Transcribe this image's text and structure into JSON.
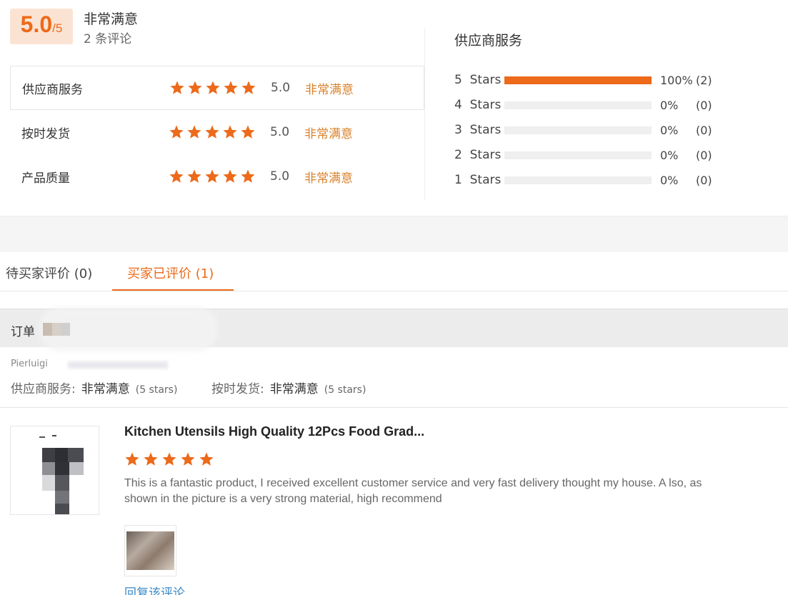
{
  "colors": {
    "accent": "#ec6a1a",
    "link": "#3a88c7"
  },
  "summary": {
    "score": "5.0",
    "score_max": "/5",
    "desc": "非常满意",
    "count": "2 条评论",
    "rows": [
      {
        "label": "供应商服务",
        "stars": 5,
        "value": "5.0",
        "word": "非常满意"
      },
      {
        "label": "按时发货",
        "stars": 5,
        "value": "5.0",
        "word": "非常满意"
      },
      {
        "label": "产品质量",
        "stars": 5,
        "value": "5.0",
        "word": "非常满意"
      }
    ]
  },
  "distribution": {
    "title": "供应商服务",
    "rows": [
      {
        "label": "5  Stars",
        "fraction": 1.0,
        "pct": "100%",
        "count": "(2)"
      },
      {
        "label": "4  Stars",
        "fraction": 0.0,
        "pct": "0%",
        "count": "(0)"
      },
      {
        "label": "3  Stars",
        "fraction": 0.0,
        "pct": "0%",
        "count": "(0)"
      },
      {
        "label": "2  Stars",
        "fraction": 0.0,
        "pct": "0%",
        "count": "(0)"
      },
      {
        "label": "1  Stars",
        "fraction": 0.0,
        "pct": "0%",
        "count": "(0)"
      }
    ]
  },
  "tabs": [
    {
      "label": "待买家评价 (0)",
      "active": false
    },
    {
      "label": "买家已评价 (1)",
      "active": true
    }
  ],
  "order": {
    "label": "订单",
    "buyer": "Pierluigi",
    "supplier_service_key": "供应商服务:",
    "supplier_service_val": "非常满意",
    "supplier_service_stars": "(5 stars)",
    "delivery_key": "按时发货:",
    "delivery_val": "非常满意",
    "delivery_stars": "(5 stars)"
  },
  "review": {
    "product_title": "Kitchen Utensils High Quality 12Pcs Food Grad...",
    "stars": 5,
    "text": "This is a fantastic product, I received excellent customer service and very fast delivery thought my house. A lso, as shown in the picture is a very strong material, high recommend",
    "reply_link": "回复该评论",
    "star_icon": "star-icon"
  }
}
